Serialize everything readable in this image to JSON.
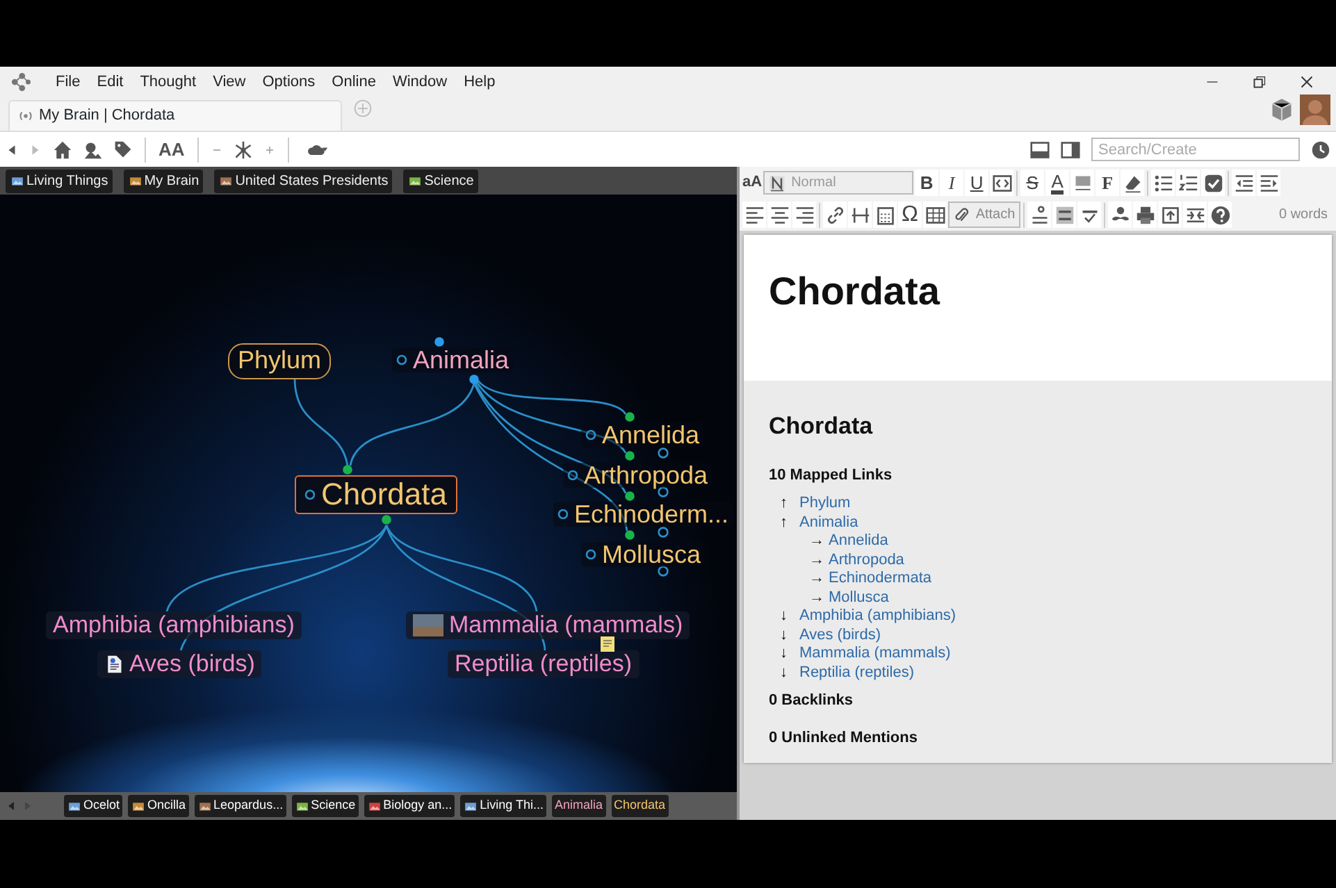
{
  "menu": [
    "File",
    "Edit",
    "Thought",
    "View",
    "Options",
    "Online",
    "Window",
    "Help"
  ],
  "tab": {
    "title": "My Brain | Chordata"
  },
  "toolbar": {
    "text_size": "AA"
  },
  "search": {
    "placeholder": "Search/Create"
  },
  "pins": [
    {
      "label": "Living Things"
    },
    {
      "label": "My Brain"
    },
    {
      "label": "United States Presidents"
    },
    {
      "label": "Science"
    }
  ],
  "nodes": [
    {
      "label": "Phylum",
      "kind": "boxed",
      "color": "#f3c66e"
    },
    {
      "label": "Animalia",
      "kind": "plain",
      "color": "#f2a3bd"
    },
    {
      "label": "Annelida",
      "kind": "plain",
      "color": "#f3c66e"
    },
    {
      "label": "Arthropoda",
      "kind": "plain",
      "color": "#f3c66e"
    },
    {
      "label": "Echinoderm...",
      "kind": "plain",
      "color": "#f3c66e"
    },
    {
      "label": "Mollusca",
      "kind": "plain",
      "color": "#f3c66e"
    },
    {
      "label": "Chordata",
      "kind": "active",
      "color": "#f3c66e"
    },
    {
      "label": "Amphibia (amphibians)",
      "kind": "child",
      "color": "#f08ccb"
    },
    {
      "label": "Aves (birds)",
      "kind": "child",
      "color": "#f08ccb"
    },
    {
      "label": "Mammalia (mammals)",
      "kind": "child",
      "color": "#f08ccb"
    },
    {
      "label": "Reptilia (reptiles)",
      "kind": "child",
      "color": "#f08ccb"
    }
  ],
  "history": [
    {
      "label": "Ocelot",
      "color": "#ffffff",
      "has_icon": true
    },
    {
      "label": "Oncilla",
      "color": "#ffffff",
      "has_icon": true
    },
    {
      "label": "Leopardus...",
      "color": "#ffffff",
      "has_icon": true
    },
    {
      "label": "Science",
      "color": "#ffffff",
      "has_icon": true
    },
    {
      "label": "Biology an...",
      "color": "#ffffff",
      "has_icon": true
    },
    {
      "label": "Living Thi...",
      "color": "#ffffff",
      "has_icon": true
    },
    {
      "label": "Animalia",
      "color": "#f2a3bd",
      "has_icon": false
    },
    {
      "label": "Chordata",
      "color": "#f3c66e",
      "has_icon": false
    }
  ],
  "editor_toolbar": {
    "font_size": "aA",
    "style": "Normal",
    "bold": "B",
    "italic": "I",
    "underline": "U",
    "strike": "S",
    "text_color": "A",
    "font": "F",
    "symbol": "Ω",
    "attach": "Attach",
    "word_count": "0 words"
  },
  "note": {
    "title": "Chordata",
    "heading": "Chordata",
    "mapped_links_heading": "10 Mapped Links",
    "links": [
      {
        "arrow": "↑",
        "label": "Phylum"
      },
      {
        "arrow": "↑",
        "label": "Animalia",
        "children": [
          {
            "arrow": "→",
            "label": "Annelida"
          },
          {
            "arrow": "→",
            "label": "Arthropoda"
          },
          {
            "arrow": "→",
            "label": "Echinodermata"
          },
          {
            "arrow": "→",
            "label": "Mollusca"
          }
        ]
      },
      {
        "arrow": "↓",
        "label": "Amphibia (amphibians)"
      },
      {
        "arrow": "↓",
        "label": "Aves (birds)"
      },
      {
        "arrow": "↓",
        "label": "Mammalia (mammals)"
      },
      {
        "arrow": "↓",
        "label": "Reptilia (reptiles)"
      }
    ],
    "backlinks": "0 Backlinks",
    "unlinked": "0 Unlinked Mentions"
  }
}
